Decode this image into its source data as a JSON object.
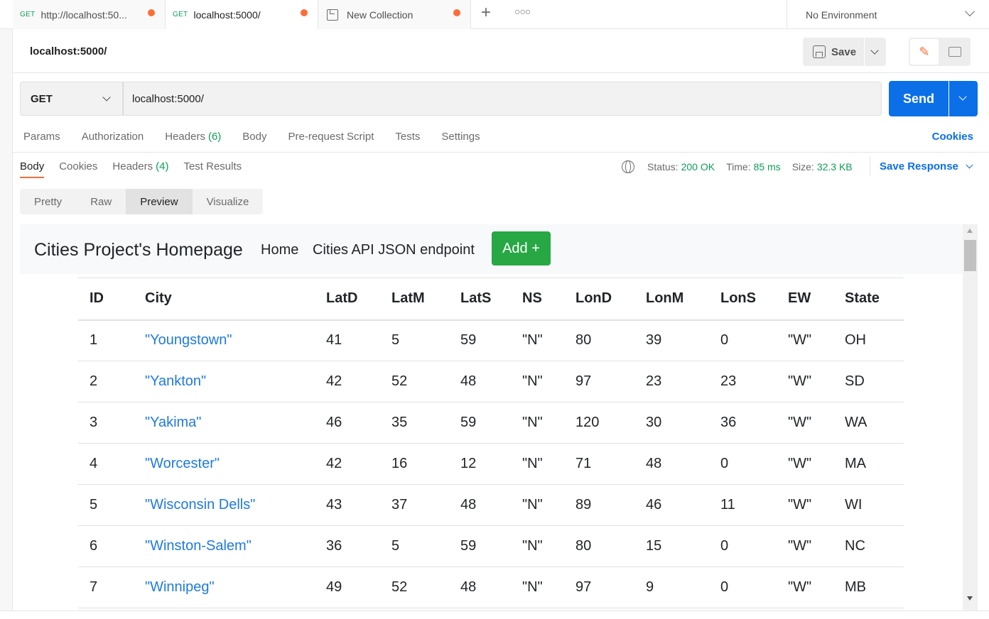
{
  "tabs": [
    {
      "method": "GET",
      "title": "http://localhost:50..."
    },
    {
      "method": "GET",
      "title": "localhost:5000/"
    },
    {
      "method": "",
      "title": "New Collection"
    }
  ],
  "environment": "No Environment",
  "request": {
    "title": "localhost:5000/",
    "save_label": "Save",
    "method": "GET",
    "url": "localhost:5000/",
    "send_label": "Send"
  },
  "request_tabs": {
    "params": "Params",
    "authorization": "Authorization",
    "headers": "Headers",
    "headers_count": "(6)",
    "body": "Body",
    "prerequest": "Pre-request Script",
    "tests": "Tests",
    "settings": "Settings",
    "cookies": "Cookies"
  },
  "response_tabs": {
    "body": "Body",
    "cookies": "Cookies",
    "headers": "Headers",
    "headers_count": "(4)",
    "test_results": "Test Results"
  },
  "response_meta": {
    "status_label": "Status:",
    "status": "200 OK",
    "time_label": "Time:",
    "time": "85 ms",
    "size_label": "Size:",
    "size": "32.3 KB",
    "save_response": "Save Response"
  },
  "view_modes": {
    "pretty": "Pretty",
    "raw": "Raw",
    "preview": "Preview",
    "visualize": "Visualize"
  },
  "preview": {
    "brand": "Cities Project's Homepage",
    "nav_home": "Home",
    "nav_api": "Cities API JSON endpoint",
    "add_button": "Add +",
    "columns": [
      "ID",
      "City",
      "LatD",
      "LatM",
      "LatS",
      "NS",
      "LonD",
      "LonM",
      "LonS",
      "EW",
      "State"
    ],
    "rows": [
      [
        "1",
        "\"Youngstown\"",
        "41",
        "5",
        "59",
        "\"N\"",
        "80",
        "39",
        "0",
        "\"W\"",
        "OH"
      ],
      [
        "2",
        "\"Yankton\"",
        "42",
        "52",
        "48",
        "\"N\"",
        "97",
        "23",
        "23",
        "\"W\"",
        "SD"
      ],
      [
        "3",
        "\"Yakima\"",
        "46",
        "35",
        "59",
        "\"N\"",
        "120",
        "30",
        "36",
        "\"W\"",
        "WA"
      ],
      [
        "4",
        "\"Worcester\"",
        "42",
        "16",
        "12",
        "\"N\"",
        "71",
        "48",
        "0",
        "\"W\"",
        "MA"
      ],
      [
        "5",
        "\"Wisconsin Dells\"",
        "43",
        "37",
        "48",
        "\"N\"",
        "89",
        "46",
        "11",
        "\"W\"",
        "WI"
      ],
      [
        "6",
        "\"Winston-Salem\"",
        "36",
        "5",
        "59",
        "\"N\"",
        "80",
        "15",
        "0",
        "\"W\"",
        "NC"
      ],
      [
        "7",
        "\"Winnipeg\"",
        "49",
        "52",
        "48",
        "\"N\"",
        "97",
        "9",
        "0",
        "\"W\"",
        "MB"
      ]
    ]
  },
  "colors": {
    "accent": "#ff6c37",
    "primary": "#0b6fe8",
    "success": "#0f9d58",
    "link": "#1f7ae0",
    "add_button": "#28a745"
  }
}
